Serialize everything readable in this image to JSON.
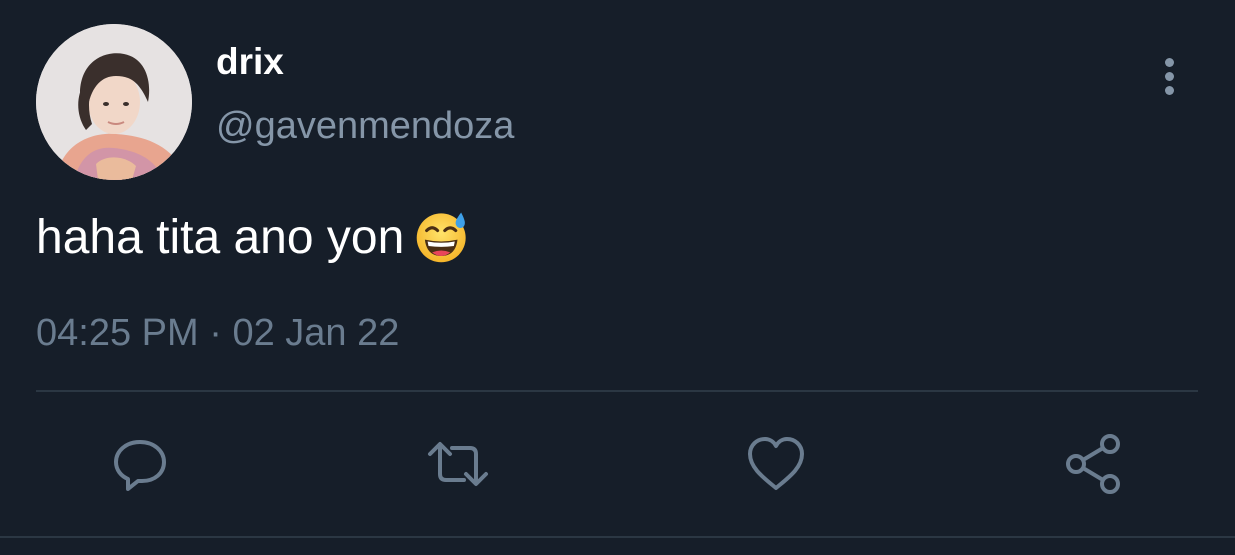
{
  "tweet": {
    "display_name": "drix",
    "handle": "@gavenmendoza",
    "text": "haha tita ano yon",
    "emoji": "grinning-face-with-sweat",
    "time": "04:25 PM",
    "separator": "·",
    "date": "02 Jan 22"
  },
  "icons": {
    "more": "more-vertical-icon",
    "reply": "reply-icon",
    "retweet": "retweet-icon",
    "like": "heart-icon",
    "share": "share-icon"
  },
  "colors": {
    "background": "#161e29",
    "primary_text": "#ffffff",
    "secondary_text": "#8596a8",
    "meta_text": "#6a7c8f",
    "divider": "#2b3743"
  }
}
